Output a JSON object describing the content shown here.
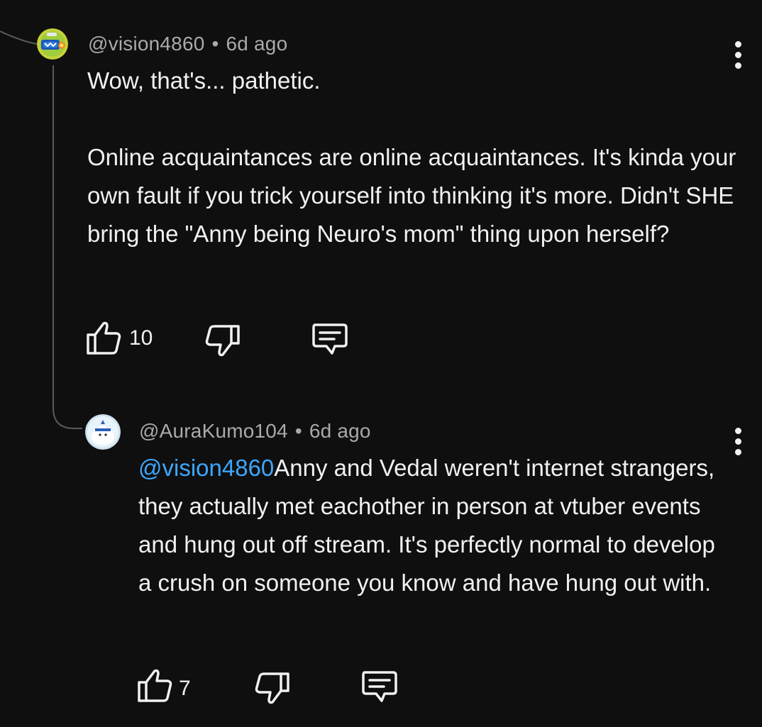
{
  "comments": [
    {
      "handle": "@vision4860",
      "separator": "•",
      "time": "6d ago",
      "text": "Wow, that's... pathetic.\n\nOnline acquaintances are online acquaintances. It's kinda your own fault if you trick yourself into thinking it's more. Didn't SHE bring the \"Anny being Neuro's mom\" thing upon herself?",
      "likes": "10",
      "avatar_icon": "robot-avatar-icon"
    },
    {
      "handle": "@AuraKumo104",
      "separator": "•",
      "time": "6d ago",
      "mention": "@vision4860",
      "text": "Anny and Vedal weren't internet strangers, they actually met eachother in person at vtuber events and hung out off stream. It's perfectly normal to develop a crush on someone you know and have hung out with.",
      "likes": "7",
      "avatar_icon": "cloud-character-avatar-icon"
    }
  ],
  "colors": {
    "background": "#0f0f0f",
    "text": "#f1f1f1",
    "secondary": "#aaaaaa",
    "mention": "#3ea6ff",
    "thread_line": "#5a5a5a"
  },
  "icons": [
    "thumbs-up-icon",
    "thumbs-down-icon",
    "reply-icon",
    "more-vert-icon"
  ]
}
